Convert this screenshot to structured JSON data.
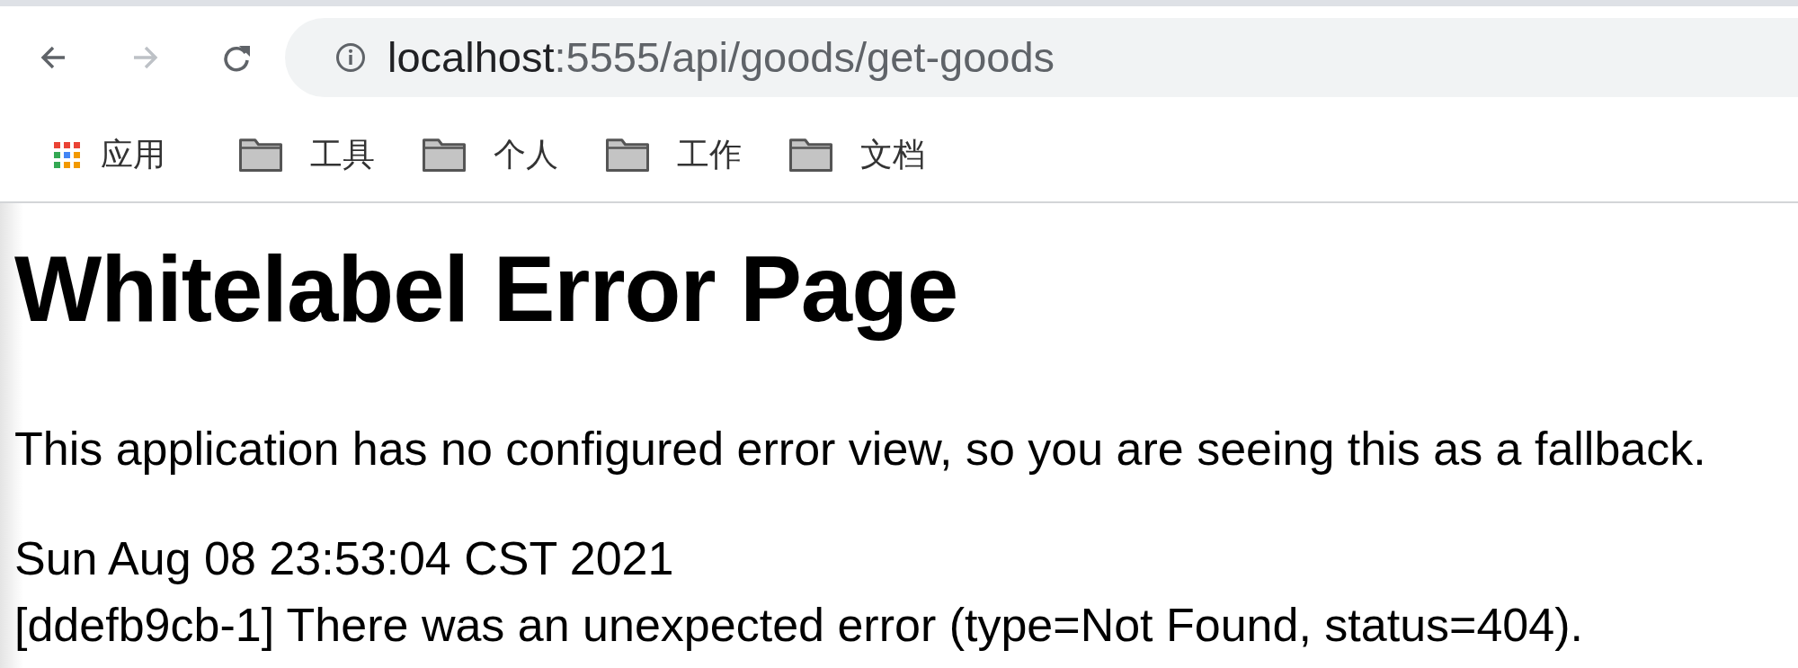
{
  "toolbar": {
    "back": {
      "disabled": false
    },
    "forward": {
      "disabled": true
    },
    "address": {
      "host": "localhost",
      "rest": ":5555/api/goods/get-goods"
    }
  },
  "bookmarks": [
    {
      "kind": "apps",
      "label": "应用"
    },
    {
      "kind": "folder",
      "label": "工具"
    },
    {
      "kind": "folder",
      "label": "个人"
    },
    {
      "kind": "folder",
      "label": "工作"
    },
    {
      "kind": "folder",
      "label": "文档"
    }
  ],
  "page": {
    "heading": "Whitelabel Error Page",
    "message": "This application has no configured error view, so you are seeing this as a fallback.",
    "lines": [
      "Sun Aug 08 23:53:04 CST 2021",
      "[ddefb9cb-1] There was an unexpected error (type=Not Found, status=404)."
    ]
  }
}
